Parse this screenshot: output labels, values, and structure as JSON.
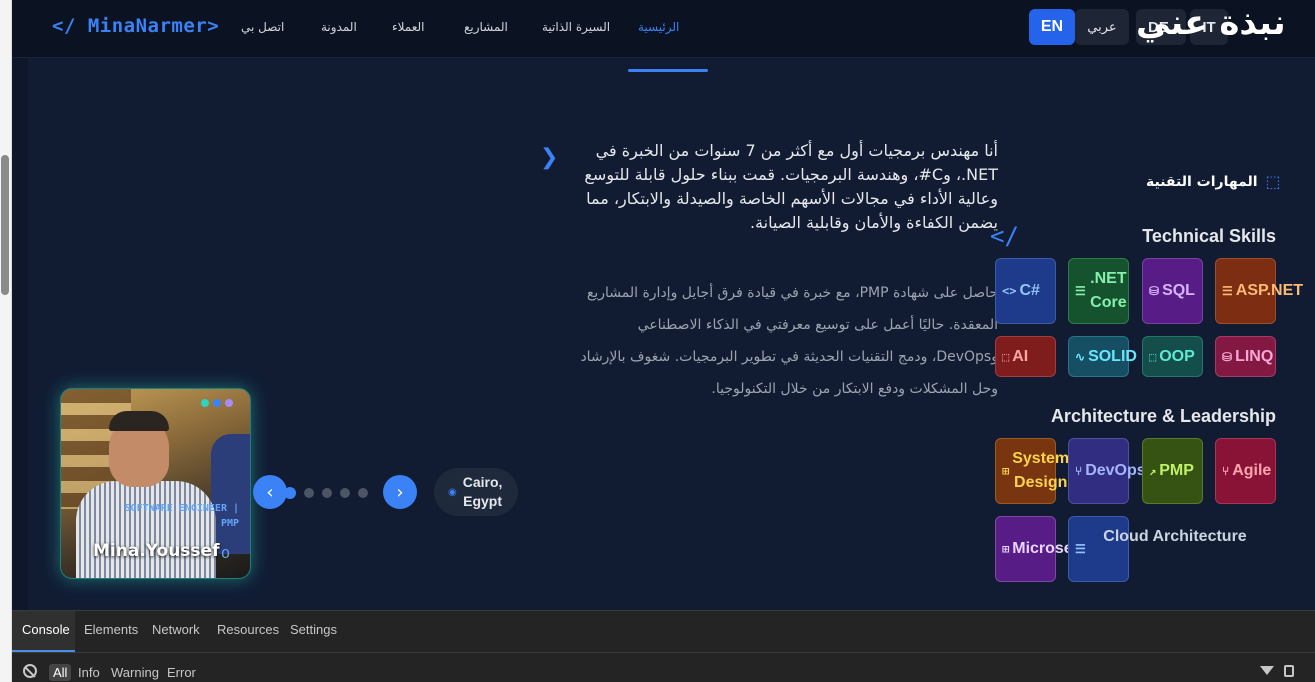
{
  "header": {
    "logo": "</ MinaNarmer>",
    "nav": [
      {
        "label": "الرئيسية",
        "active": true
      },
      {
        "label": "السيرة الذاتية",
        "active": false
      },
      {
        "label": "المشاريع",
        "active": false
      },
      {
        "label": "العملاء",
        "active": false
      },
      {
        "label": "المدونة",
        "active": false
      },
      {
        "label": "اتصل بي",
        "active": false
      }
    ],
    "languages": {
      "en": "EN",
      "ar": "عربي",
      "de": "DE",
      "it": "IT"
    },
    "about_title": "نبذة عني"
  },
  "hero": {
    "bio_main": "أنا مهندس برمجيات أول مع أكثر من 7 سنوات من الخبرة في NET.، وC#، وهندسة البرمجيات. قمت ببناء حلول قابلة للتوسع وعالية الأداء في مجالات الأسهم الخاصة والصيدلة والابتكار، مما يضمن الكفاءة والأمان وقابلية الصيانة.",
    "bio_sub": "حاصل على شهادة PMP، مع خبرة في قيادة فرق أجايل وإدارة المشاريع المعقدة. حاليًا أعمل على توسيع معرفتي في الذكاء الاصطناعي وDevOps، ودمج التقنيات الحديثة في تطوير البرمجيات. شغوف بالإرشاد وحل المشكلات ودفع الابتكار من خلال التكنولوجيا."
  },
  "profile": {
    "role_line1": "SOFTWARE ENGINEER |",
    "role_line2": "PMP",
    "name": "Mina.Youssef",
    "location_city": "Cairo,",
    "location_country": "Egypt",
    "slider_count": 5,
    "slider_active": 0
  },
  "skills": {
    "heading": "المهارات التقنية",
    "technical_title": "Technical Skills",
    "technical": [
      {
        "label": "C#",
        "icon": "code-icon",
        "bg": "#1e3a8a",
        "fg": "#93c5fd"
      },
      {
        "label": ".NET Core",
        "icon": "server-icon",
        "bg": "#14532d",
        "fg": "#86efac"
      },
      {
        "label": "SQL",
        "icon": "database-icon",
        "bg": "#581c87",
        "fg": "#d8b4fe"
      },
      {
        "label": "ASP.NET",
        "icon": "server-icon",
        "bg": "#7c2d12",
        "fg": "#fdba74"
      },
      {
        "label": "AI",
        "icon": "chip-icon",
        "bg": "#7f1d1d",
        "fg": "#fca5a5"
      },
      {
        "label": "SOLID",
        "icon": "activity-icon",
        "bg": "#164e63",
        "fg": "#67e8f9"
      },
      {
        "label": "OOP",
        "icon": "chip-icon",
        "bg": "#134e4a",
        "fg": "#5eead4"
      },
      {
        "label": "LINQ",
        "icon": "database-icon",
        "bg": "#831843",
        "fg": "#f9a8d4"
      }
    ],
    "leadership_title": "Architecture & Leadership",
    "leadership": [
      {
        "label": "System Design",
        "icon": "grid-icon",
        "bg": "#78350f",
        "fg": "#fcd34d"
      },
      {
        "label": "DevOps",
        "icon": "branch-icon",
        "bg": "#312e81",
        "fg": "#a5b4fc"
      },
      {
        "label": "PMP",
        "icon": "chart-icon",
        "bg": "#365314",
        "fg": "#bef264"
      },
      {
        "label": "Agile",
        "icon": "branch-icon",
        "bg": "#881337",
        "fg": "#fda4af"
      },
      {
        "label": "Microservices",
        "icon": "grid-icon",
        "bg": "#581c87",
        "fg": "#e9d5ff"
      },
      {
        "label": "Cloud Architecture",
        "icon": "server-icon",
        "bg": "#1e3a8a",
        "fg": "#93c5fd"
      }
    ]
  },
  "devtools": {
    "tabs": [
      "Console",
      "Elements",
      "Network",
      "Resources",
      "Settings"
    ],
    "active_tab": "Console",
    "filters": [
      "All",
      "Info",
      "Warning",
      "Error"
    ],
    "active_filter": "All"
  }
}
